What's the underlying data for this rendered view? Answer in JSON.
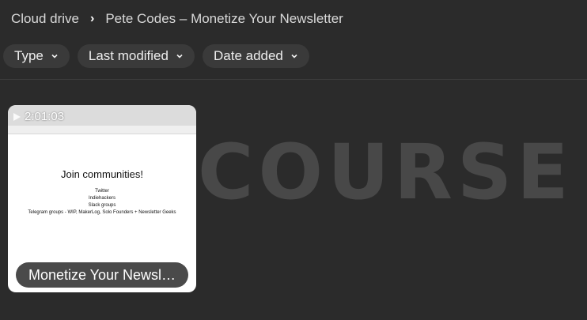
{
  "breadcrumb": {
    "root": "Cloud drive",
    "current": "Pete Codes – Monetize Your Newsletter"
  },
  "filters": [
    {
      "label": "Type"
    },
    {
      "label": "Last modified"
    },
    {
      "label": "Date added"
    }
  ],
  "watermark": {
    "text": "COURSE"
  },
  "card": {
    "duration": "2:01:03",
    "title": "Monetize Your Newsl…",
    "thumbnail": {
      "heading": "Join communities!",
      "lines": [
        "Twitter",
        "Indiehackers",
        "Slack groups",
        "Telegram groups - WIP, MakerLog, Solo Founders + Newsletter Geeks"
      ]
    }
  },
  "colors": {
    "background": "#2b2b2b",
    "chip": "#3a3a3a",
    "card_label": "#4a4a4a",
    "watermark_accent": "#e05a5a"
  }
}
